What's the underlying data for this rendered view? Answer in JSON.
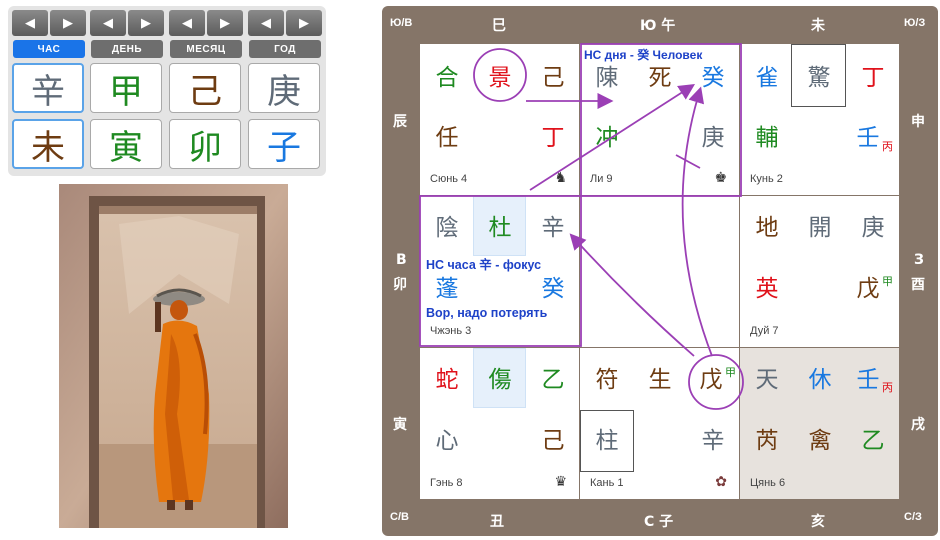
{
  "panel": {
    "nav": [
      {
        "prev": "◀",
        "next": "▶"
      },
      {
        "prev": "◀",
        "next": "▶"
      },
      {
        "prev": "◀",
        "next": "▶"
      },
      {
        "prev": "◀",
        "next": "▶"
      }
    ],
    "tabs": [
      "ЧАС",
      "ДЕНЬ",
      "МЕСЯЦ",
      "ГОД"
    ],
    "active_tab": "ЧАС",
    "stems": [
      "辛",
      "甲",
      "己",
      "庚"
    ],
    "branches": [
      "未",
      "寅",
      "卯",
      "子"
    ]
  },
  "board": {
    "corners": {
      "top_left": "Ю/В",
      "top_right": "Ю/З",
      "bottom_left": "С/В",
      "bottom_right": "С/З"
    },
    "top": [
      "巳",
      "Ю 午",
      "未"
    ],
    "bottom": [
      "丑",
      "С 子",
      "亥"
    ],
    "left": [
      "辰",
      "В",
      "卯",
      "寅"
    ],
    "right": [
      "申",
      "З",
      "酉",
      "戌"
    ]
  },
  "palaces": {
    "xun4": {
      "name": "Сюнь 4",
      "row1": [
        "合",
        "景",
        "己"
      ],
      "row2": [
        "任",
        "丁"
      ]
    },
    "li9": {
      "name": "Ли 9",
      "annotation": "НС дня - 癸 Человек",
      "row1": [
        "陳",
        "死",
        "癸"
      ],
      "row2": [
        "冲",
        "庚"
      ],
      "icon": "♚"
    },
    "kun2": {
      "name": "Кунь 2",
      "row1": [
        "雀",
        "驚",
        "丁"
      ],
      "row2": [
        "輔",
        "壬"
      ],
      "sup": "丙"
    },
    "zhen3": {
      "name": "Чжэнь 3",
      "row1": [
        "陰",
        "杜",
        "辛"
      ],
      "annotation_top": "НС часа 辛 - фокус",
      "row2": [
        "蓬",
        "癸"
      ],
      "annotation_bottom": "Вор, надо потерять"
    },
    "dui7": {
      "name": "Дуй 7",
      "row1": [
        "地",
        "開",
        "庚"
      ],
      "row2": [
        "英",
        "戊"
      ],
      "sup": "甲"
    },
    "gen8": {
      "name": "Гэнь 8",
      "row1": [
        "蛇",
        "傷",
        "乙"
      ],
      "row2": [
        "心",
        "己"
      ],
      "icon": "♛"
    },
    "kan1": {
      "name": "Кань 1",
      "row1": [
        "符",
        "生",
        "戊"
      ],
      "sup": "甲",
      "row2": [
        "柱",
        "辛"
      ],
      "icon": "✿"
    },
    "qian6": {
      "name": "Цянь 6",
      "row1": [
        "天",
        "休",
        "壬"
      ],
      "sup": "丙",
      "row2": [
        "芮",
        "禽",
        "乙"
      ]
    }
  },
  "colors": {
    "board": "#857568",
    "accent": "#1a74e8",
    "annotation": "#1e42c8",
    "arrow": "#9b3fb5"
  }
}
